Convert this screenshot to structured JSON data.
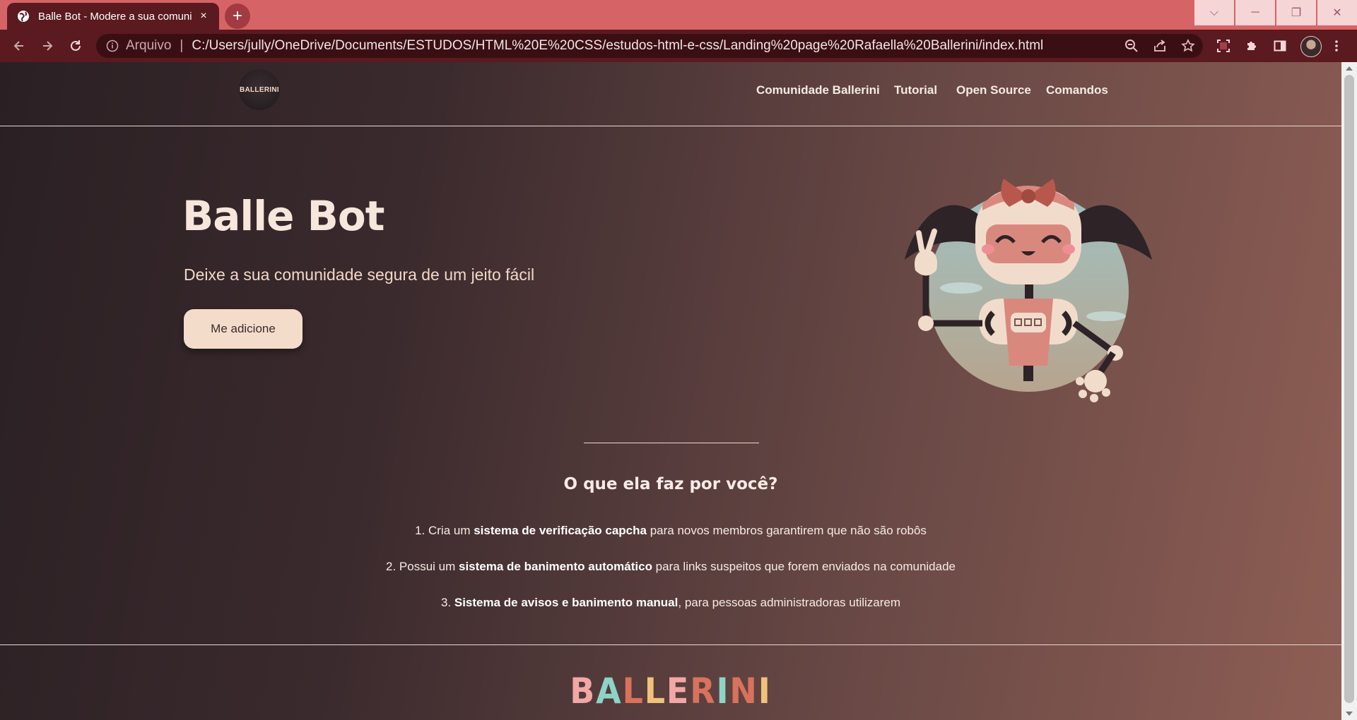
{
  "browser": {
    "tab_title": "Balle Bot - Modere a sua comuni",
    "tab_close": "×",
    "new_tab": "+",
    "address_prefix": "Arquivo",
    "address_separator": "|",
    "url": "C:/Users/jully/OneDrive/Documents/ESTUDOS/HTML%20E%20CSS/estudos-html-e-css/Landing%20page%20Rafaella%20Ballerini/index.html",
    "window_controls": {
      "dropdown": "⌵",
      "minimize": "─",
      "restore": "❐",
      "close": "✕"
    },
    "icons": {
      "back": "back-arrow-icon",
      "forward": "forward-arrow-icon",
      "reload": "reload-icon",
      "info": "info-icon",
      "zoom": "zoom-out-icon",
      "share": "share-icon",
      "bookmark": "star-icon",
      "screenshot": "screen-capture-icon",
      "extensions": "puzzle-icon",
      "sidepanel": "side-panel-icon",
      "menu": "kebab-menu-icon"
    }
  },
  "page": {
    "logo_text": "BALLERINI",
    "nav": [
      "Comunidade Ballerini",
      "Tutorial",
      "Open Source",
      "Comandos"
    ],
    "hero": {
      "title": "Balle Bot",
      "subtitle": "Deixe a sua comunidade segura de um jeito fácil",
      "cta": "Me adicione"
    },
    "features": {
      "title": "O que ela faz por você?",
      "items": [
        {
          "prefix": "1. Cria um ",
          "bold": "sistema de verificação capcha",
          "suffix": " para novos membros garantirem que não são robôs"
        },
        {
          "prefix": "2. Possui um ",
          "bold": "sistema de banimento automático",
          "suffix": " para links suspeitos que forem enviados na comunidade"
        },
        {
          "prefix": "3. ",
          "bold": "Sistema de avisos e banimento manual",
          "suffix": ", para pessoas administradoras utilizarem"
        }
      ]
    },
    "footer_brand": {
      "letters": [
        "B",
        "A",
        "L",
        "L",
        "E",
        "R",
        "I",
        "N",
        "I"
      ],
      "colors": [
        "#f2a7a7",
        "#8fd3c8",
        "#d9725c",
        "#f0c27a",
        "#f2a7a7",
        "#d9725c",
        "#8fd3c8",
        "#d9725c",
        "#f0c27a"
      ]
    },
    "colors": {
      "accent": "#f4dccb",
      "tab_bar": "#d66466",
      "toolbar": "#5a1a20"
    }
  }
}
